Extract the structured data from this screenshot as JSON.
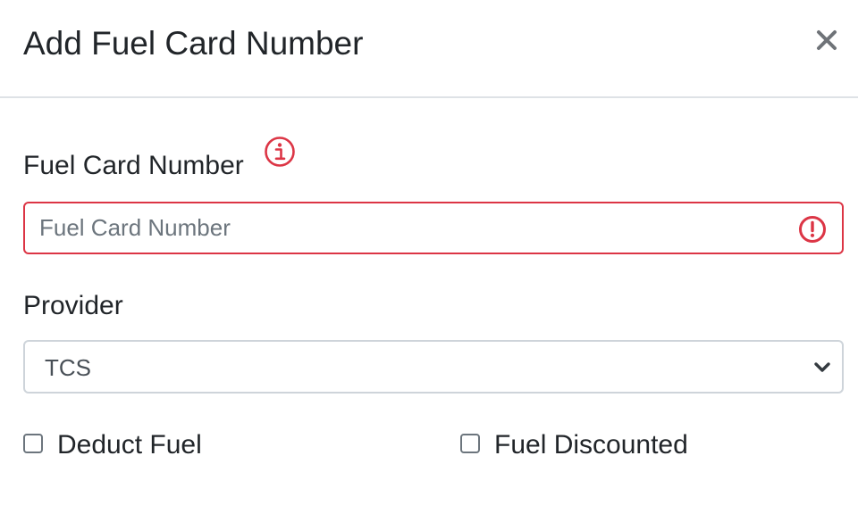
{
  "modal": {
    "title": "Add Fuel Card Number",
    "close_symbol": "×"
  },
  "form": {
    "card_number": {
      "label": "Fuel Card Number",
      "placeholder": "Fuel Card Number",
      "value": "",
      "info_icon": "info-circle-icon",
      "error_icon": "exclamation-circle-icon",
      "state": "invalid"
    },
    "provider": {
      "label": "Provider",
      "selected": "TCS",
      "chevron_icon": "chevron-down-icon"
    },
    "checkboxes": [
      {
        "label": "Deduct Fuel",
        "checked": false
      },
      {
        "label": "Fuel Discounted",
        "checked": false
      }
    ]
  },
  "colors": {
    "error": "#dc3545",
    "border": "#ced4da",
    "divider": "#dee2e6",
    "text": "#212529",
    "muted": "#6c757d"
  }
}
